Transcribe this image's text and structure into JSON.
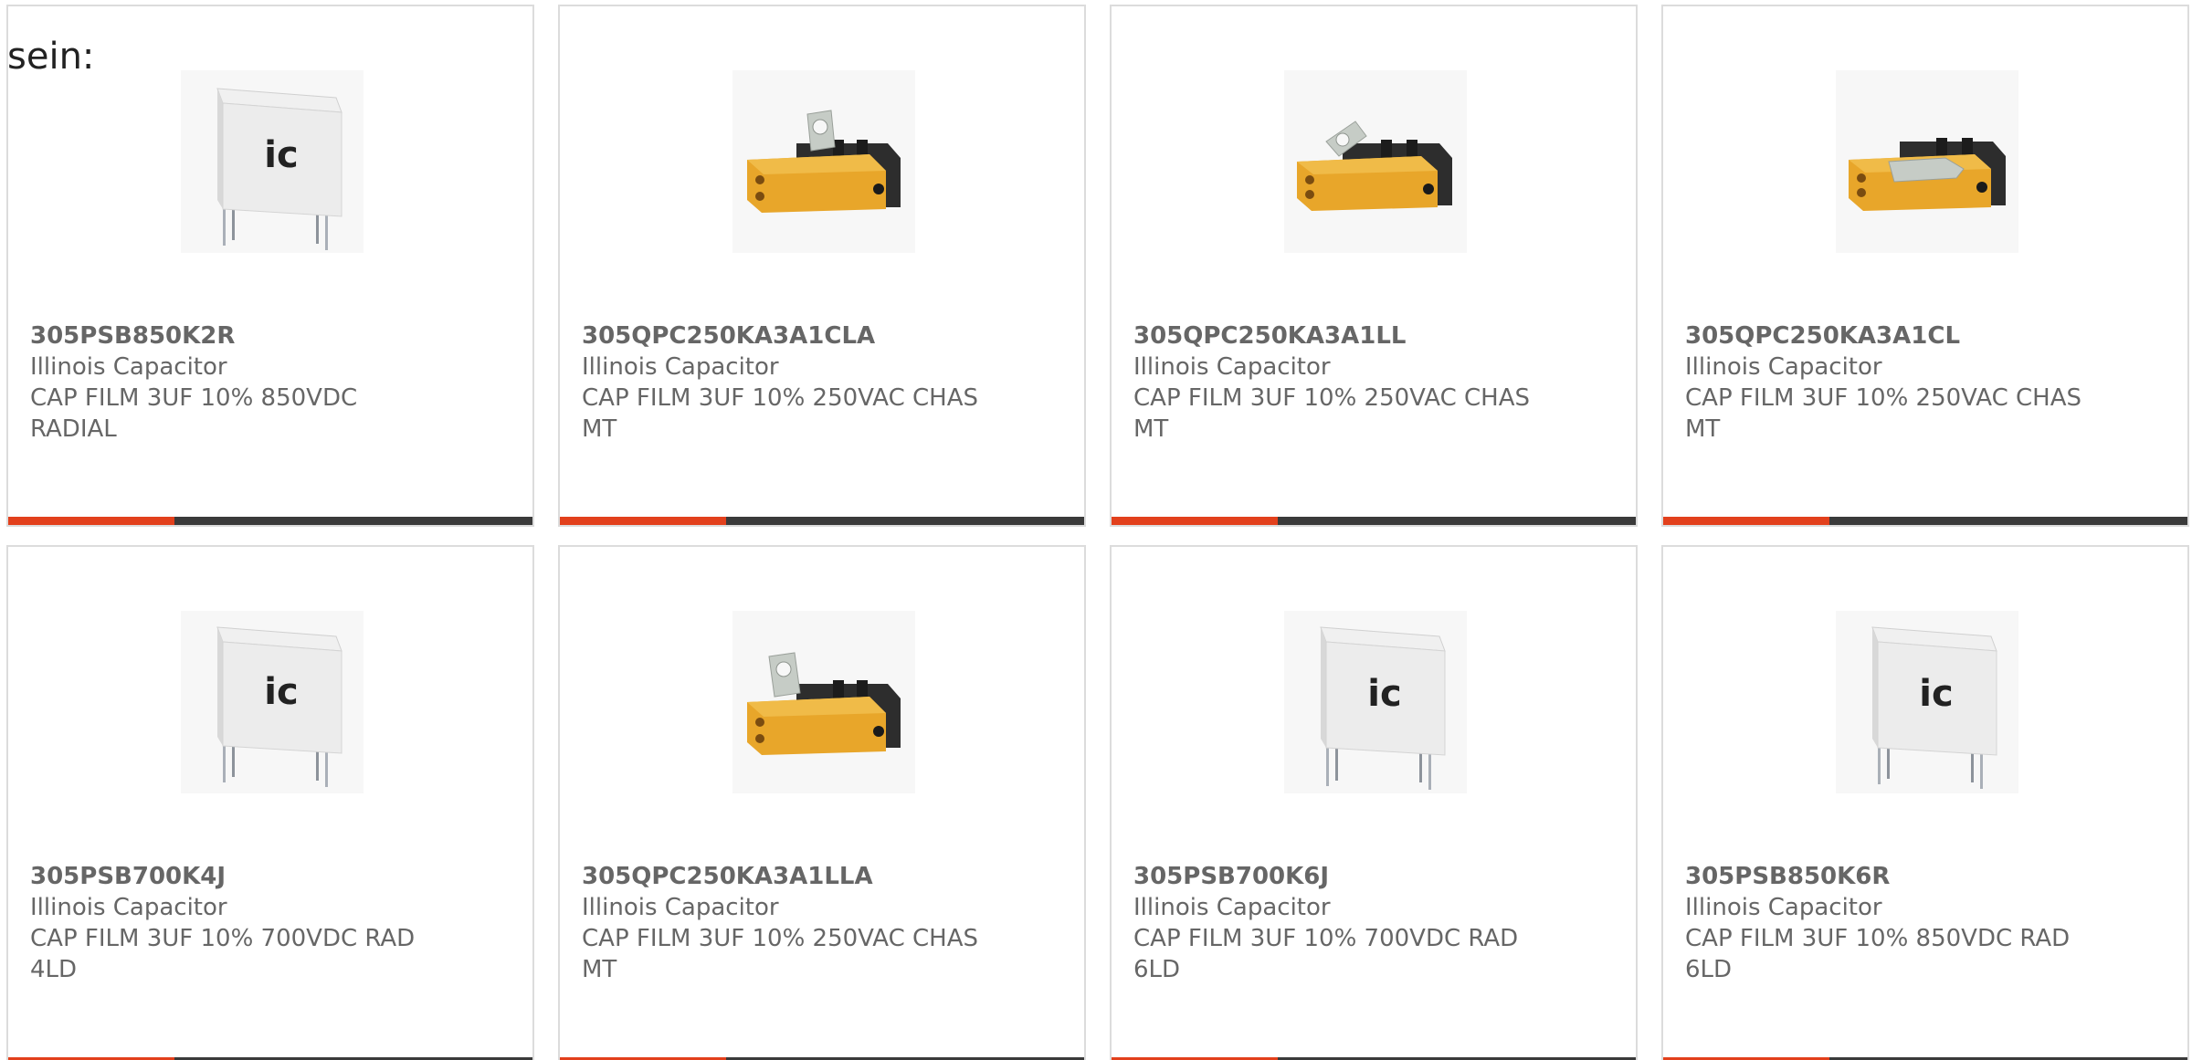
{
  "intro_text": "sein:",
  "colors": {
    "accent": "#e2401c",
    "bar_dark": "#3a3a3a",
    "card_border": "#dcdcdc",
    "text": "#666666"
  },
  "cards": [
    {
      "part": "305PSB850K2R",
      "maker": "Illinois Capacitor",
      "desc": "CAP FILM 3UF 10% 850VDC RADIAL",
      "image": "film-capacitor-radial-icon"
    },
    {
      "part": "305QPC250KA3A1CLA",
      "maker": "Illinois Capacitor",
      "desc": "CAP FILM 3UF 10% 250VAC CHAS MT",
      "image": "chassis-mount-capacitor-icon"
    },
    {
      "part": "305QPC250KA3A1LL",
      "maker": "Illinois Capacitor",
      "desc": "CAP FILM 3UF 10% 250VAC CHAS MT",
      "image": "chassis-mount-capacitor-icon"
    },
    {
      "part": "305QPC250KA3A1CL",
      "maker": "Illinois Capacitor",
      "desc": "CAP FILM 3UF 10% 250VAC CHAS MT",
      "image": "chassis-mount-capacitor-icon"
    },
    {
      "part": "305PSB700K4J",
      "maker": "Illinois Capacitor",
      "desc": "CAP FILM 3UF 10% 700VDC RAD 4LD",
      "image": "film-capacitor-radial-icon"
    },
    {
      "part": "305QPC250KA3A1LLA",
      "maker": "Illinois Capacitor",
      "desc": "CAP FILM 3UF 10% 250VAC CHAS MT",
      "image": "chassis-mount-capacitor-icon"
    },
    {
      "part": "305PSB700K6J",
      "maker": "Illinois Capacitor",
      "desc": "CAP FILM 3UF 10% 700VDC RAD 6LD",
      "image": "film-capacitor-radial-icon"
    },
    {
      "part": "305PSB850K6R",
      "maker": "Illinois Capacitor",
      "desc": "CAP FILM 3UF 10% 850VDC RAD 6LD",
      "image": "film-capacitor-radial-icon"
    }
  ]
}
